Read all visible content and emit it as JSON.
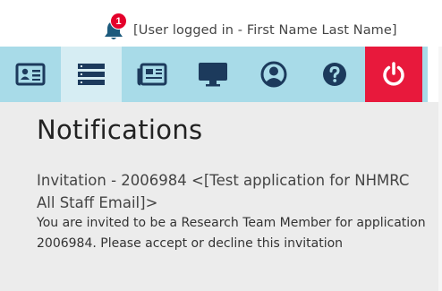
{
  "header": {
    "notification_count": "1",
    "user_label": "[User logged in - First Name Last Name]"
  },
  "nav": {
    "items": [
      {
        "icon": "id-card-icon",
        "active": false
      },
      {
        "icon": "server-list-icon",
        "active": true
      },
      {
        "icon": "newspaper-icon",
        "active": false
      },
      {
        "icon": "monitor-icon",
        "active": false
      },
      {
        "icon": "user-circle-icon",
        "active": false
      },
      {
        "icon": "help-icon",
        "active": false
      },
      {
        "icon": "power-icon",
        "active": false
      }
    ],
    "colors": {
      "bar": "#a8dbe8",
      "active": "#d6edf3",
      "power": "#e8193c",
      "icon": "#1c3a5c"
    }
  },
  "main": {
    "page_title": "Notifications",
    "notification": {
      "title": "Invitation - 2006984 <[Test application for NHMRC All Staff Email]>",
      "body": "You are invited to be a Research Team Member for application 2006984. Please accept or decline this invitation"
    }
  }
}
